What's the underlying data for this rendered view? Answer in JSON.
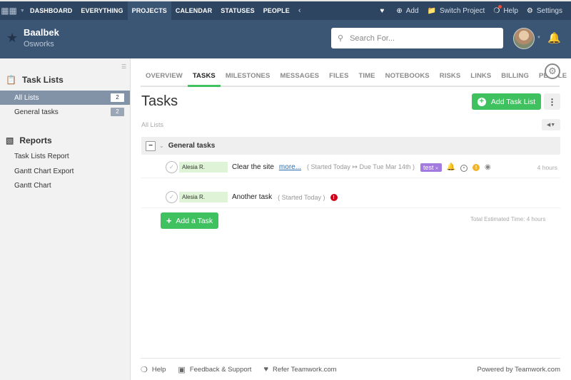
{
  "topnav": {
    "logo": "teamwork-logo",
    "items": [
      {
        "label": "DASHBOARD",
        "active": false
      },
      {
        "label": "EVERYTHING",
        "active": false
      },
      {
        "label": "PROJECTS",
        "active": true
      },
      {
        "label": "CALENDAR",
        "active": false
      },
      {
        "label": "STATUSES",
        "active": false
      },
      {
        "label": "PEOPLE",
        "active": false
      }
    ],
    "right": {
      "add_label": "Add",
      "switch_project_label": "Switch Project",
      "help_label": "Help",
      "settings_label": "Settings"
    }
  },
  "header": {
    "project_name": "Baalbek",
    "company_name": "Osworks",
    "search_placeholder": "Search For..."
  },
  "sidebar": {
    "task_lists_title": "Task Lists",
    "lists": [
      {
        "label": "All Lists",
        "count": "2",
        "active": true
      },
      {
        "label": "General tasks",
        "count": "2",
        "active": false
      }
    ],
    "reports_title": "Reports",
    "reports": [
      {
        "label": "Task Lists Report"
      },
      {
        "label": "Gantt Chart Export"
      },
      {
        "label": "Gantt Chart"
      }
    ]
  },
  "tabs": [
    {
      "label": "OVERVIEW",
      "active": false
    },
    {
      "label": "TASKS",
      "active": true
    },
    {
      "label": "MILESTONES",
      "active": false
    },
    {
      "label": "MESSAGES",
      "active": false
    },
    {
      "label": "FILES",
      "active": false
    },
    {
      "label": "TIME",
      "active": false
    },
    {
      "label": "NOTEBOOKS",
      "active": false
    },
    {
      "label": "RISKS",
      "active": false
    },
    {
      "label": "LINKS",
      "active": false
    },
    {
      "label": "BILLING",
      "active": false
    },
    {
      "label": "PEOPLE",
      "active": false
    }
  ],
  "main": {
    "title": "Tasks",
    "add_task_list_label": "Add Task List",
    "breadcrumb": "All Lists",
    "group": {
      "name": "General tasks",
      "tasks": [
        {
          "assignee": "Alesia R.",
          "name": "Clear the site",
          "more_label": "more...",
          "dates": "( Started Today ↦ Due Tue Mar 14th )",
          "tag": "test",
          "estimate": "4 hours"
        },
        {
          "assignee": "Alesia R.",
          "name": "Another task",
          "dates": "( Started Today )"
        }
      ]
    },
    "add_task_label": "Add a Task",
    "total_estimate": "Total Estimated Time: 4 hours"
  },
  "footer": {
    "help_label": "Help",
    "feedback_label": "Feedback & Support",
    "refer_label": "Refer Teamwork.com",
    "powered_by": "Powered by Teamwork.com"
  },
  "colors": {
    "nav_bg": "#2e4561",
    "header_bg": "#3b5575",
    "accent_green": "#3ec15e",
    "tag_purple": "#a27ae0",
    "active_list_bg": "#8293a8"
  }
}
